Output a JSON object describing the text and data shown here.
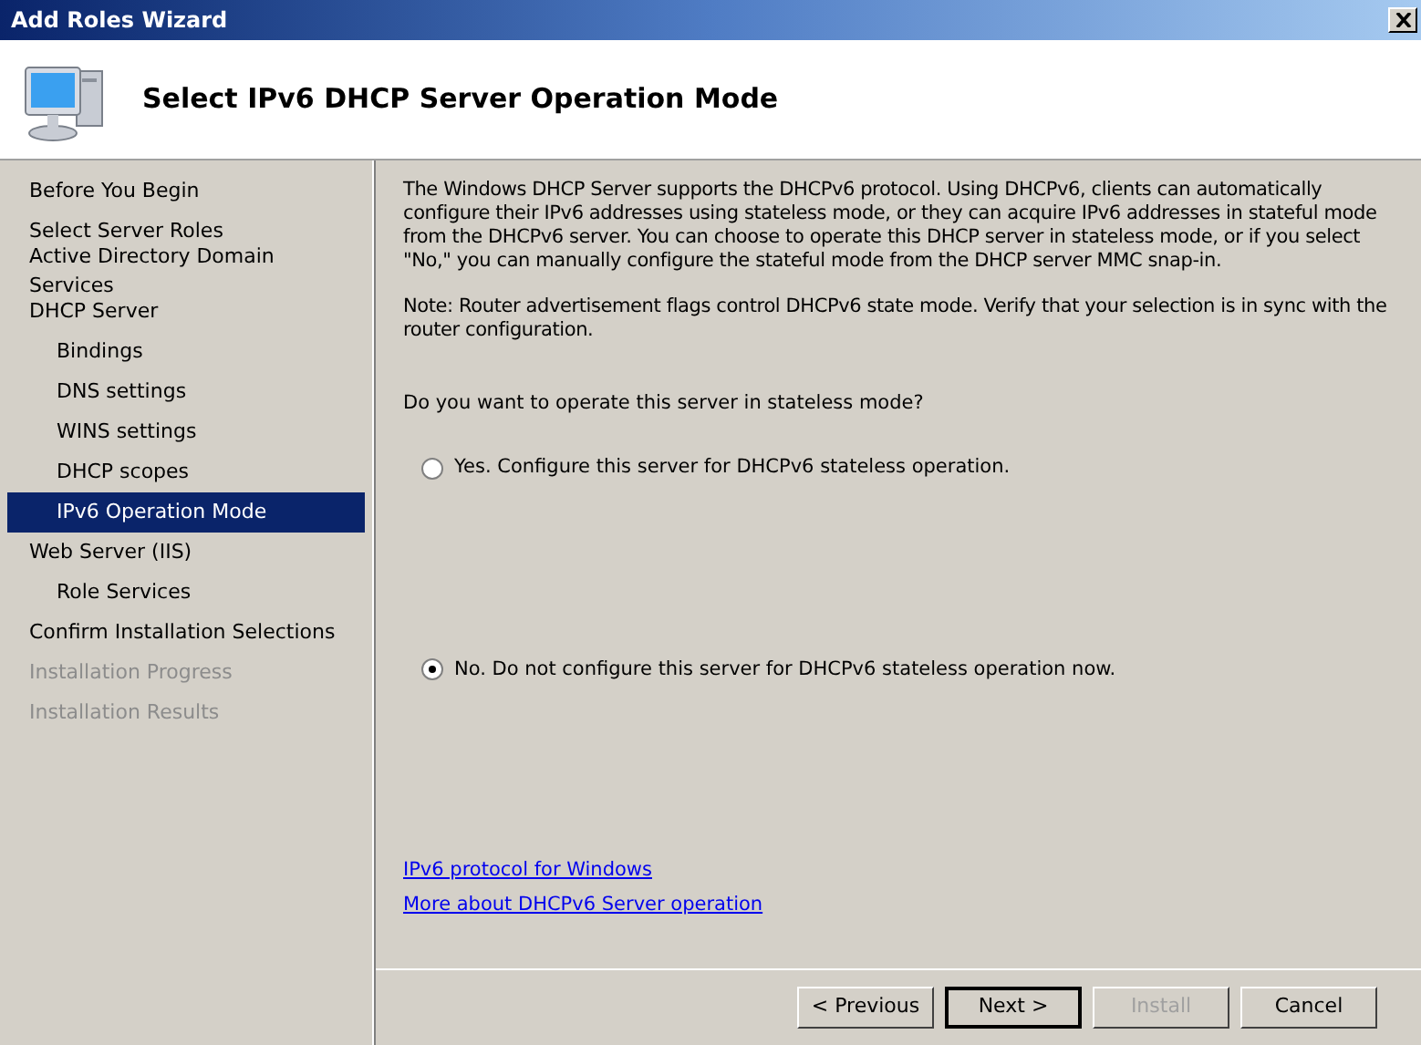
{
  "window": {
    "title": "Add Roles Wizard"
  },
  "header": {
    "title": "Select IPv6 DHCP Server Operation Mode"
  },
  "sidebar": {
    "items": [
      {
        "label": "Before You Begin",
        "selected": false,
        "disabled": false
      },
      {
        "label": "Select Server Roles",
        "selected": false,
        "disabled": false
      },
      {
        "label": "Active Directory Domain Services",
        "selected": false,
        "disabled": false
      },
      {
        "label": "DHCP Server",
        "selected": false,
        "disabled": false,
        "children": [
          {
            "label": "Bindings",
            "selected": false,
            "disabled": false
          },
          {
            "label": "DNS settings",
            "selected": false,
            "disabled": false
          },
          {
            "label": "WINS settings",
            "selected": false,
            "disabled": false
          },
          {
            "label": "DHCP scopes",
            "selected": false,
            "disabled": false
          },
          {
            "label": "IPv6 Operation Mode",
            "selected": true,
            "disabled": false
          }
        ]
      },
      {
        "label": "Web Server (IIS)",
        "selected": false,
        "disabled": false,
        "children": [
          {
            "label": "Role Services",
            "selected": false,
            "disabled": false
          }
        ]
      },
      {
        "label": "Confirm Installation Selections",
        "selected": false,
        "disabled": false
      },
      {
        "label": "Installation Progress",
        "selected": false,
        "disabled": true
      },
      {
        "label": "Installation Results",
        "selected": false,
        "disabled": true
      }
    ]
  },
  "content": {
    "description": "The Windows DHCP Server supports the DHCPv6 protocol. Using DHCPv6, clients can automatically configure their IPv6 addresses using stateless mode, or they can acquire IPv6 addresses in stateful mode from the DHCPv6 server. You can choose to operate this DHCP server in stateless mode, or if you select \"No,\" you can manually configure the stateful mode from the DHCP server MMC snap-in.",
    "note": "Note: Router advertisement flags control DHCPv6 state mode. Verify that your selection is in sync with the router configuration.",
    "question": "Do you want to operate this server in stateless mode?",
    "options": [
      {
        "label": "Yes. Configure this server for DHCPv6 stateless operation.",
        "selected": false
      },
      {
        "label": "No. Do not configure this server for DHCPv6 stateless operation now.",
        "selected": true
      }
    ],
    "links": [
      "IPv6 protocol for Windows",
      "More about DHCPv6 Server operation"
    ]
  },
  "buttons": [
    {
      "label": "< Previous",
      "disabled": false,
      "default": false
    },
    {
      "label": "Next >",
      "disabled": false,
      "default": true
    },
    {
      "label": "Install",
      "disabled": true,
      "default": false
    },
    {
      "label": "Cancel",
      "disabled": false,
      "default": false
    }
  ]
}
